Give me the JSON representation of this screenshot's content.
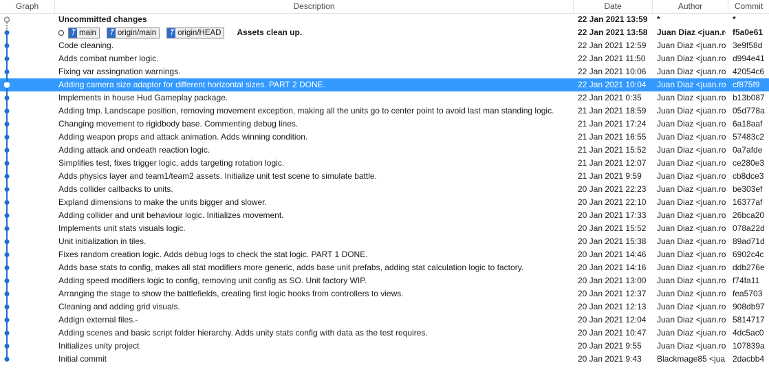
{
  "columns": {
    "graph": "Graph",
    "description": "Description",
    "date": "Date",
    "author": "Author",
    "commit": "Commit"
  },
  "refs": [
    {
      "icon": "branch-icon",
      "label": "main"
    },
    {
      "icon": "branch-icon",
      "label": "origin/main"
    },
    {
      "icon": "branch-icon",
      "label": "origin/HEAD"
    }
  ],
  "commits": [
    {
      "description": "Uncommitted changes",
      "date": "22 Jan 2021 13:59",
      "author": "*",
      "commit": "*",
      "bold": true,
      "uncommitted": true
    },
    {
      "description": "Assets clean up.",
      "date": "22 Jan 2021 13:58",
      "author": "Juan Diaz <juan.rc",
      "commit": "f5a0e61",
      "bold": true,
      "has_refs": true
    },
    {
      "description": "Code cleaning.",
      "date": "22 Jan 2021 12:59",
      "author": "Juan Diaz <juan.ro",
      "commit": "3e9f58d"
    },
    {
      "description": "Adds combat number logic.",
      "date": "22 Jan 2021 11:50",
      "author": "Juan Diaz <juan.ro",
      "commit": "d994e41"
    },
    {
      "description": "Fixing var assingnation warnings.",
      "date": "22 Jan 2021 10:06",
      "author": "Juan Diaz <juan.ro",
      "commit": "42054c6"
    },
    {
      "description": "Adding camera size adaptor for different horizontal sizes. PART 2 DONE.",
      "date": "22 Jan 2021 10:04",
      "author": "Juan Diaz <juan.ro",
      "commit": "cf875f9",
      "selected": true
    },
    {
      "description": "Implements in house Hud Gameplay package.",
      "date": "22 Jan 2021 0:35",
      "author": "Juan Diaz <juan.ro",
      "commit": "b13b087"
    },
    {
      "description": "Adding tmp. Landscape position, removing movement exception, making all the units go to center point to avoid last man standing logic.",
      "date": "21 Jan 2021 18:59",
      "author": "Juan Diaz <juan.ro",
      "commit": "05d778a"
    },
    {
      "description": "Changing movement to rigidbody base. Commenting debug lines.",
      "date": "21 Jan 2021 17:24",
      "author": "Juan Diaz <juan.ro",
      "commit": "6a18aaf"
    },
    {
      "description": "Adding weapon props and attack animation. Adds winning condition.",
      "date": "21 Jan 2021 16:55",
      "author": "Juan Diaz <juan.ro",
      "commit": "57483c2"
    },
    {
      "description": "Adding attack and ondeath reaction logic.",
      "date": "21 Jan 2021 15:52",
      "author": "Juan Diaz <juan.ro",
      "commit": "0a7afde"
    },
    {
      "description": "Simplifies test, fixes trigger logic, adds targeting rotation logic.",
      "date": "21 Jan 2021 12:07",
      "author": "Juan Diaz <juan.ro",
      "commit": "ce280e3"
    },
    {
      "description": "Adds physics layer and team1/team2 assets. Initialize unit test scene to simulate battle.",
      "date": "21 Jan 2021 9:59",
      "author": "Juan Diaz <juan.ro",
      "commit": "cb8dce3"
    },
    {
      "description": "Adds collider callbacks to units.",
      "date": "20 Jan 2021 22:23",
      "author": "Juan Diaz <juan.ro",
      "commit": "be303ef"
    },
    {
      "description": "Expland dimensions to make the units bigger and slower.",
      "date": "20 Jan 2021 22:10",
      "author": "Juan Diaz <juan.ro",
      "commit": "16377af"
    },
    {
      "description": "Adding collider and unit behaviour logic. Initializes movement.",
      "date": "20 Jan 2021 17:33",
      "author": "Juan Diaz <juan.ro",
      "commit": "26bca20"
    },
    {
      "description": "Implements unit stats visuals logic.",
      "date": "20 Jan 2021 15:52",
      "author": "Juan Diaz <juan.ro",
      "commit": "078a22d"
    },
    {
      "description": "Unit initialization in tiles.",
      "date": "20 Jan 2021 15:38",
      "author": "Juan Diaz <juan.ro",
      "commit": "89ad71d"
    },
    {
      "description": "Fixes random creation logic. Adds debug logs to check the stat logic. PART 1 DONE.",
      "date": "20 Jan 2021 14:46",
      "author": "Juan Diaz <juan.ro",
      "commit": "6902c4c"
    },
    {
      "description": "Adds base stats to config, makes all stat modifiers more generic, adds base unit prefabs, adding stat calculation logic to factory.",
      "date": "20 Jan 2021 14:16",
      "author": "Juan Diaz <juan.ro",
      "commit": "ddb276e"
    },
    {
      "description": "Adding speed modifiers logic to config, removing unit config as SO. Unit factory WIP.",
      "date": "20 Jan 2021 13:00",
      "author": "Juan Diaz <juan.ro",
      "commit": "f74fa11"
    },
    {
      "description": "Arranging the stage to show the battlefields, creating first logic hooks from controllers to views.",
      "date": "20 Jan 2021 12:37",
      "author": "Juan Diaz <juan.ro",
      "commit": "fea5703"
    },
    {
      "description": "Cleaning and adding grid visuals.",
      "date": "20 Jan 2021 12:13",
      "author": "Juan Diaz <juan.ro",
      "commit": "908db97"
    },
    {
      "description": "Addign external files.-",
      "date": "20 Jan 2021 12:04",
      "author": "Juan Diaz <juan.ro",
      "commit": "5814717"
    },
    {
      "description": "Adding scenes and basic script folder hierarchy. Adds unity stats config with data as the test requires.",
      "date": "20 Jan 2021 10:47",
      "author": "Juan Diaz <juan.ro",
      "commit": "4dc5ac0"
    },
    {
      "description": "Initializes unity project",
      "date": "20 Jan 2021 9:55",
      "author": "Juan Diaz <juan.ro",
      "commit": "107839a"
    },
    {
      "description": "Initial commit",
      "date": "20 Jan 2021 9:43",
      "author": "Blackmage85 <jua",
      "commit": "2dacbb4"
    }
  ],
  "colors": {
    "graph_line": "#1f6fd1",
    "selected_row": "#3399ff",
    "ref_icon": "#2f6cc8"
  }
}
